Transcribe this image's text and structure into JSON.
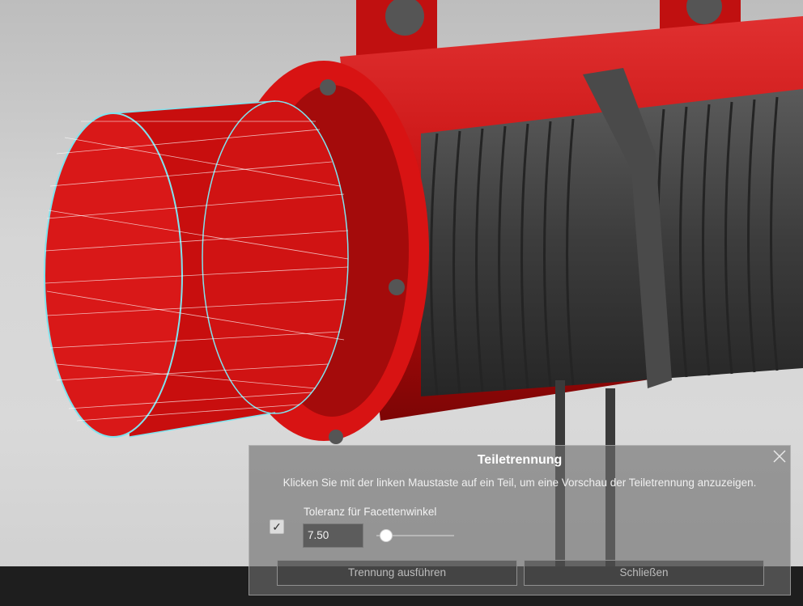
{
  "dialog": {
    "title": "Teiletrennung",
    "description": "Klicken Sie mit der linken Maustaste auf ein Teil, um eine Vorschau der Teiletrennung anzuzeigen.",
    "facet_tolerance": {
      "label": "Toleranz für Facettenwinkel",
      "enabled": true,
      "value": "7.50"
    },
    "buttons": {
      "run": "Trennung ausführen",
      "close": "Schließen"
    },
    "close_icon": "close-icon"
  },
  "colors": {
    "model_red": "#d10f0f",
    "drum_gray": "#3c3c3c",
    "selection_cyan": "#7fe3ee",
    "bottom_bar": "#1e1e1e"
  }
}
